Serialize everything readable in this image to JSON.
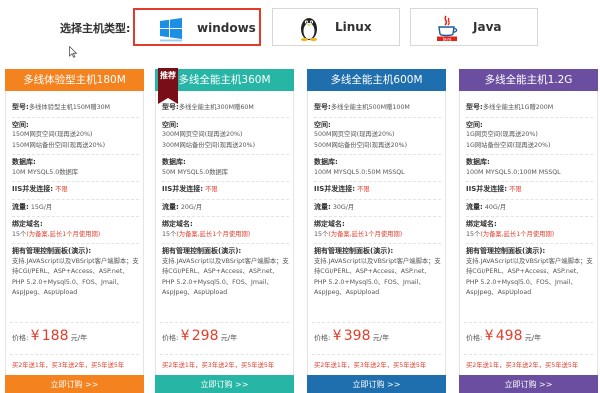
{
  "os_selector": {
    "label": "选择主机类型:",
    "options": [
      {
        "name": "windows",
        "icon": "windows-icon",
        "active": true
      },
      {
        "name": "Linux",
        "icon": "linux-penguin-icon",
        "active": false
      },
      {
        "name": "Java",
        "icon": "java-icon",
        "active": false
      }
    ]
  },
  "plans": [
    {
      "title": "多线体验型主机180M",
      "color": "#f4831f",
      "badge": "",
      "model_label": "型号:",
      "model": "多线体验型主机150M赠30M",
      "space_label": "空间:",
      "space": [
        "150M网页空间(现再送20%)",
        "150M网站备份空间(现再送20%)"
      ],
      "db_label": "数据库:",
      "db": "10M MYSQL5.0数据库",
      "iis_label": "IIS并发连接:",
      "iis": "不限",
      "traffic_label": "流量:",
      "traffic": "15G/月",
      "domain_label": "绑定域名:",
      "domain_prefix": "15个",
      "domain_note": "(为备案,延长1个月使用期)",
      "panel_label": "拥有管理控制面板(演示):",
      "panel": "支持.JAVAScript以及VBSript客户端脚本；支持CGI/PERL、ASP+Access、ASP.net、PHP 5.2.0+Mysql5.0、FOS、Jmail、AspJpeg、AspUpload",
      "price_label": "价格:",
      "price_symbol": "¥",
      "price": "188",
      "price_unit": "元/年",
      "promo": "买2年送1年，买3年送2年，买5年送5年",
      "buy_label": "立即订购 >>"
    },
    {
      "title": "多线全能主机360M",
      "color": "#27b6a6",
      "badge": "推荐",
      "model_label": "型号:",
      "model": "多线全能主机300M赠60M",
      "space_label": "空间:",
      "space": [
        "300M网页空间(现再送20%)",
        "300M网站备份空间(现再送20%)"
      ],
      "db_label": "数据库:",
      "db": "50M MYSQL5.0数据库",
      "iis_label": "IIS并发连接:",
      "iis": "不限",
      "traffic_label": "流量:",
      "traffic": "20G/月",
      "domain_label": "绑定域名:",
      "domain_prefix": "15个",
      "domain_note": "(为备案,延长1个月使用期)",
      "panel_label": "拥有管理控制面板(演示):",
      "panel": "支持.JAVAScript以及VBSript客户端脚本；支持CGI/PERL、ASP+Access、ASP.net、PHP 5.2.0+Mysql5.0、FOS、Jmail、AspJpeg、AspUpload",
      "price_label": "价格:",
      "price_symbol": "¥",
      "price": "298",
      "price_unit": "元/年",
      "promo": "买2年送1年，买3年送2年，买5年送5年",
      "buy_label": "立即订购 >>"
    },
    {
      "title": "多线全能主机600M",
      "color": "#1f6fae",
      "badge": "",
      "model_label": "型号:",
      "model": "多线全能主机500M赠100M",
      "space_label": "空间:",
      "space": [
        "500M网页空间(现再送20%)",
        "500M网站备份空间(现再送20%)"
      ],
      "db_label": "数据库:",
      "db": "100M MYSQL5.0;50M MSSQL",
      "iis_label": "IIS并发连接:",
      "iis": "不限",
      "traffic_label": "流量:",
      "traffic": "30G/月",
      "domain_label": "绑定域名:",
      "domain_prefix": "15个",
      "domain_note": "(为备案,延长1个月使用期)",
      "panel_label": "拥有管理控制面板(演示):",
      "panel": "支持.JAVAScript以及VBSript客户端脚本；支持CGI/PERL、ASP+Access、ASP.net、PHP 5.2.0+Mysql5.0、FOS、Jmail、AspJpeg、AspUpload",
      "price_label": "价格:",
      "price_symbol": "¥",
      "price": "398",
      "price_unit": "元/年",
      "promo": "买2年送1年，买3年送2年，买5年送5年",
      "buy_label": "立即订购 >>"
    },
    {
      "title": "多线全能主机1.2G",
      "color": "#6b4ea0",
      "badge": "",
      "model_label": "型号:",
      "model": "多线全能主机1G赠200M",
      "space_label": "空间:",
      "space": [
        "1G网页空间(现再送20%)",
        "1G网站备份空间(现再送20%)"
      ],
      "db_label": "数据库:",
      "db": "100M MYSQL5.0;100M MSSQL",
      "iis_label": "IIS并发连接:",
      "iis": "不限",
      "traffic_label": "流量:",
      "traffic": "40G/月",
      "domain_label": "绑定域名:",
      "domain_prefix": "15个",
      "domain_note": "(为备案,延长1个月使用期)",
      "panel_label": "拥有管理控制面板(演示):",
      "panel": "支持.JAVAScript以及VBSript客户端脚本；支持CGI/PERL、ASP+Access、ASP.net、PHP 5.2.0+Mysql5.0、FOS、Jmail、AspJpeg、AspUpload",
      "price_label": "价格:",
      "price_symbol": "¥",
      "price": "498",
      "price_unit": "元/年",
      "promo": "买2年送1年，买3年送2年，买5年送5年",
      "buy_label": "立即订购 >>"
    }
  ]
}
